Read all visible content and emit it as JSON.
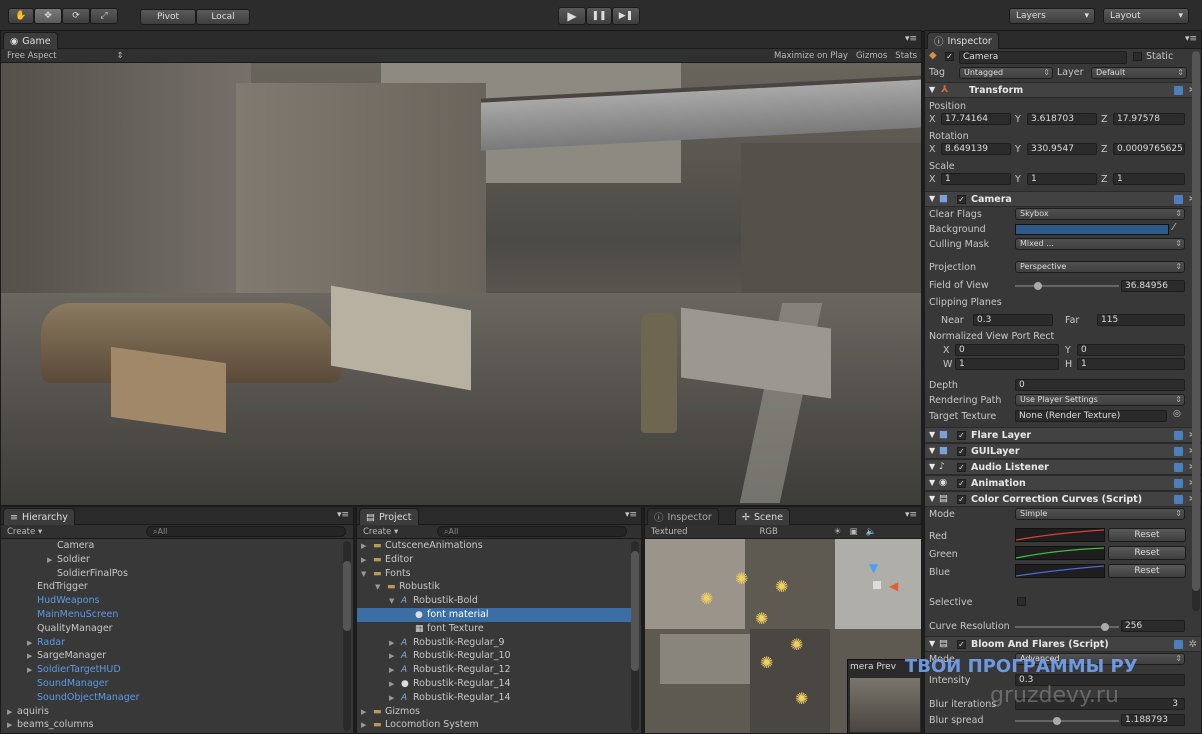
{
  "toolbar": {
    "tools": [
      "✋",
      "✥",
      "⟳",
      "⤢"
    ],
    "pivot": "Pivot",
    "local": "Local",
    "play": "▶",
    "pause": "❚❚",
    "step": "▶❚",
    "layers": "Layers",
    "layout": "Layout"
  },
  "game": {
    "tab": "Game",
    "aspect": "Free Aspect",
    "maximize": "Maximize on Play",
    "gizmos": "Gizmos",
    "stats": "Stats"
  },
  "hierarchy": {
    "tab": "Hierarchy",
    "create": "Create",
    "search": "All",
    "items": [
      {
        "label": "Camera",
        "indent": 4,
        "blue": false,
        "arrow": ""
      },
      {
        "label": "Soldier",
        "indent": 4,
        "blue": false,
        "arrow": "▶"
      },
      {
        "label": "SoldierFinalPos",
        "indent": 4,
        "blue": false,
        "arrow": ""
      },
      {
        "label": "EndTrigger",
        "indent": 2,
        "blue": false,
        "arrow": ""
      },
      {
        "label": "HudWeapons",
        "indent": 2,
        "blue": true,
        "arrow": ""
      },
      {
        "label": "MainMenuScreen",
        "indent": 2,
        "blue": true,
        "arrow": ""
      },
      {
        "label": "QualityManager",
        "indent": 2,
        "blue": false,
        "arrow": ""
      },
      {
        "label": "Radar",
        "indent": 2,
        "blue": true,
        "arrow": "▶"
      },
      {
        "label": "SargeManager",
        "indent": 2,
        "blue": false,
        "arrow": "▶"
      },
      {
        "label": "SoldierTargetHUD",
        "indent": 2,
        "blue": true,
        "arrow": "▶"
      },
      {
        "label": "SoundManager",
        "indent": 2,
        "blue": true,
        "arrow": ""
      },
      {
        "label": "SoundObjectManager",
        "indent": 2,
        "blue": true,
        "arrow": ""
      },
      {
        "label": "aquiris",
        "indent": 0,
        "blue": false,
        "arrow": "▶"
      },
      {
        "label": "beams_columns",
        "indent": 0,
        "blue": false,
        "arrow": "▶"
      }
    ]
  },
  "project": {
    "tab": "Project",
    "create": "Create",
    "search": "All",
    "items": [
      {
        "label": "CutsceneAnimations",
        "level": 0,
        "arrow": "▶",
        "icon": "folder",
        "sel": false
      },
      {
        "label": "Editor",
        "level": 0,
        "arrow": "▶",
        "icon": "folder",
        "sel": false
      },
      {
        "label": "Fonts",
        "level": 0,
        "arrow": "▼",
        "icon": "folder",
        "sel": false
      },
      {
        "label": "Robustik",
        "level": 1,
        "arrow": "▼",
        "icon": "folder",
        "sel": false
      },
      {
        "label": "Robustik-Bold",
        "level": 2,
        "arrow": "▼",
        "icon": "font",
        "sel": false
      },
      {
        "label": "font material",
        "level": 3,
        "arrow": "",
        "icon": "sphere",
        "sel": true
      },
      {
        "label": "font Texture",
        "level": 3,
        "arrow": "",
        "icon": "texture",
        "sel": false
      },
      {
        "label": "Robustik-Regular_9",
        "level": 2,
        "arrow": "▶",
        "icon": "font",
        "sel": false
      },
      {
        "label": "Robustik-Regular_10",
        "level": 2,
        "arrow": "▶",
        "icon": "font",
        "sel": false
      },
      {
        "label": "Robustik-Regular_12",
        "level": 2,
        "arrow": "▶",
        "icon": "font",
        "sel": false
      },
      {
        "label": "Robustik-Regular_14",
        "level": 2,
        "arrow": "▶",
        "icon": "sphere",
        "sel": false
      },
      {
        "label": "Robustik-Regular_14",
        "level": 2,
        "arrow": "▶",
        "icon": "font",
        "sel": false
      },
      {
        "label": "Gizmos",
        "level": 0,
        "arrow": "▶",
        "icon": "folder",
        "sel": false
      },
      {
        "label": "Locomotion System",
        "level": 0,
        "arrow": "▶",
        "icon": "folder",
        "sel": false
      }
    ]
  },
  "scene": {
    "tab_inspector": "Inspector",
    "tab_scene": "Scene",
    "mode": "Textured",
    "channel": "RGB",
    "preview": "mera Prev"
  },
  "inspector": {
    "tab": "Inspector",
    "name": "Camera",
    "static": "Static",
    "tag_label": "Tag",
    "tag": "Untagged",
    "layer_label": "Layer",
    "layer": "Default",
    "transform": {
      "title": "Transform",
      "position": "Position",
      "rotation": "Rotation",
      "scale": "Scale",
      "pos": {
        "x": "17.74164",
        "y": "3.618703",
        "z": "17.97578"
      },
      "rot": {
        "x": "8.649139",
        "y": "330.9547",
        "z": "0.0009765625"
      },
      "scl": {
        "x": "1",
        "y": "1",
        "z": "1"
      }
    },
    "camera": {
      "title": "Camera",
      "clear_flags": "Clear Flags",
      "clear_flags_val": "Skybox",
      "background": "Background",
      "culling": "Culling Mask",
      "culling_val": "Mixed ...",
      "projection": "Projection",
      "projection_val": "Perspective",
      "fov": "Field of View",
      "fov_val": "36.84956",
      "fov_frac": 0.2,
      "clipping": "Clipping Planes",
      "near": "Near",
      "near_val": "0.3",
      "far": "Far",
      "far_val": "115",
      "viewport": "Normalized View Port Rect",
      "vx": "0",
      "vy": "0",
      "vw": "1",
      "vh": "1",
      "depth": "Depth",
      "depth_val": "0",
      "render_path": "Rendering Path",
      "render_path_val": "Use Player Settings",
      "target": "Target Texture",
      "target_val": "None (Render Texture)"
    },
    "components": [
      "Flare Layer",
      "GUILayer",
      "Audio Listener",
      "Animation",
      "Color Correction Curves (Script)"
    ],
    "ccc": {
      "mode": "Mode",
      "mode_val": "Simple",
      "red": "Red",
      "green": "Green",
      "blue": "Blue",
      "reset": "Reset",
      "selective": "Selective",
      "curve_res": "Curve Resolution",
      "curve_res_val": "256",
      "curve_frac": 0.9
    },
    "bloom": {
      "title": "Bloom And Flares (Script)",
      "mode": "Mode",
      "mode_val": "Advanced",
      "intensity": "Intensity",
      "intensity_val": "0.3",
      "blur_it": "Blur iterations",
      "blur_it_val": "3",
      "blur_sp": "Blur spread",
      "blur_sp_val": "1.188793",
      "blur_sp_frac": 0.4
    }
  },
  "watermark": {
    "line1": "ТВОИ ПРОГРАММЫ РУ",
    "line2": "gruzdevy.ru"
  },
  "colors": {
    "panel": "#383838",
    "select": "#3a6ea5",
    "link": "#5a9be6",
    "bg_color": "#2e5a8a"
  }
}
